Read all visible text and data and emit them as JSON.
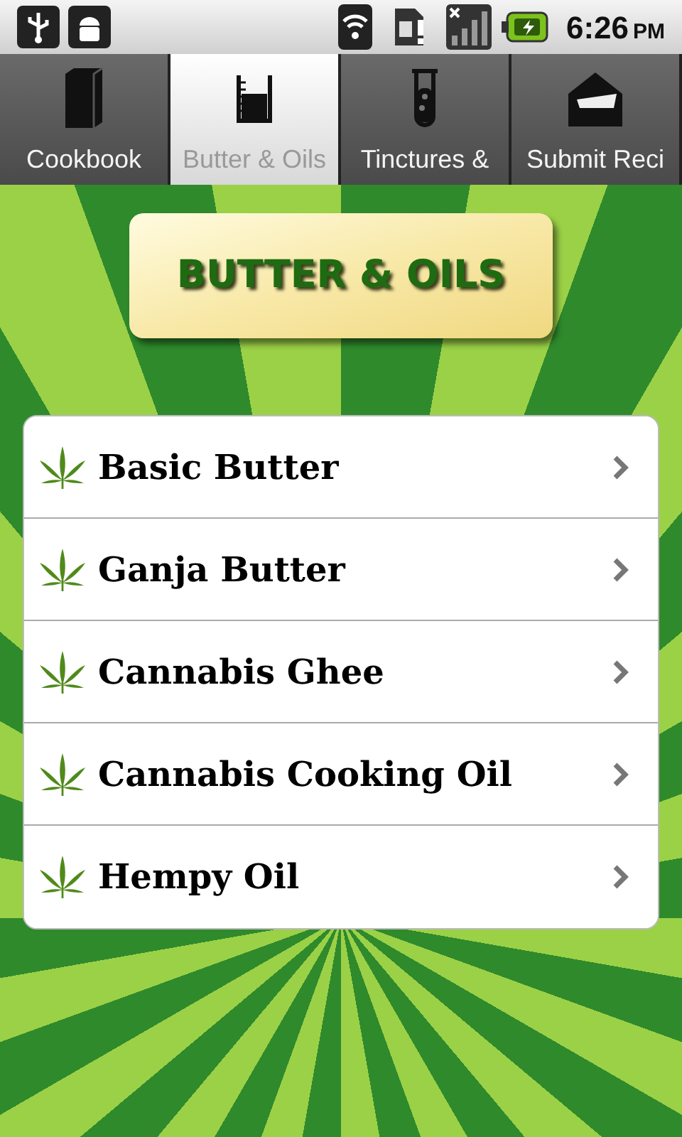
{
  "status_bar": {
    "time": "6:26",
    "ampm": "PM"
  },
  "tabs": [
    {
      "label": "Cookbook",
      "selected": false
    },
    {
      "label": "Butter & Oils",
      "selected": true
    },
    {
      "label": "Tinctures &",
      "selected": false
    },
    {
      "label": "Submit Reci",
      "selected": false
    }
  ],
  "banner": {
    "title": "BUTTER & OILS"
  },
  "recipes": [
    {
      "title": "Basic Butter"
    },
    {
      "title": "Ganja Butter"
    },
    {
      "title": "Cannabis Ghee"
    },
    {
      "title": "Cannabis Cooking Oil"
    },
    {
      "title": "Hempy Oil"
    }
  ]
}
